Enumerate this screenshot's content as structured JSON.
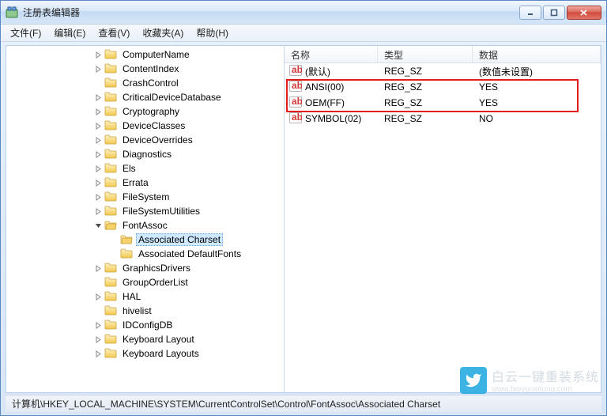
{
  "window": {
    "title": "注册表编辑器"
  },
  "menu": {
    "file": "文件(F)",
    "edit": "编辑(E)",
    "view": "查看(V)",
    "favorites": "收藏夹(A)",
    "help": "帮助(H)"
  },
  "tree": {
    "items": [
      {
        "indent": 110,
        "exp": "collapsed",
        "label": "ComputerName"
      },
      {
        "indent": 110,
        "exp": "collapsed",
        "label": "ContentIndex"
      },
      {
        "indent": 110,
        "exp": "none",
        "label": "CrashControl"
      },
      {
        "indent": 110,
        "exp": "collapsed",
        "label": "CriticalDeviceDatabase"
      },
      {
        "indent": 110,
        "exp": "collapsed",
        "label": "Cryptography"
      },
      {
        "indent": 110,
        "exp": "collapsed",
        "label": "DeviceClasses"
      },
      {
        "indent": 110,
        "exp": "collapsed",
        "label": "DeviceOverrides"
      },
      {
        "indent": 110,
        "exp": "collapsed",
        "label": "Diagnostics"
      },
      {
        "indent": 110,
        "exp": "collapsed",
        "label": "Els"
      },
      {
        "indent": 110,
        "exp": "collapsed",
        "label": "Errata"
      },
      {
        "indent": 110,
        "exp": "collapsed",
        "label": "FileSystem"
      },
      {
        "indent": 110,
        "exp": "collapsed",
        "label": "FileSystemUtilities"
      },
      {
        "indent": 110,
        "exp": "expanded",
        "label": "FontAssoc"
      },
      {
        "indent": 130,
        "exp": "none",
        "label": "Associated Charset",
        "selected": true
      },
      {
        "indent": 130,
        "exp": "none",
        "label": "Associated DefaultFonts"
      },
      {
        "indent": 110,
        "exp": "collapsed",
        "label": "GraphicsDrivers"
      },
      {
        "indent": 110,
        "exp": "none",
        "label": "GroupOrderList"
      },
      {
        "indent": 110,
        "exp": "collapsed",
        "label": "HAL"
      },
      {
        "indent": 110,
        "exp": "none",
        "label": "hivelist"
      },
      {
        "indent": 110,
        "exp": "collapsed",
        "label": "IDConfigDB"
      },
      {
        "indent": 110,
        "exp": "collapsed",
        "label": "Keyboard Layout"
      },
      {
        "indent": 110,
        "exp": "collapsed",
        "label": "Keyboard Layouts"
      }
    ]
  },
  "list": {
    "columns": {
      "name": "名称",
      "type": "类型",
      "data": "数据"
    },
    "rows": [
      {
        "name": "(默认)",
        "type": "REG_SZ",
        "data": "(数值未设置)"
      },
      {
        "name": "ANSI(00)",
        "type": "REG_SZ",
        "data": "YES"
      },
      {
        "name": "OEM(FF)",
        "type": "REG_SZ",
        "data": "YES"
      },
      {
        "name": "SYMBOL(02)",
        "type": "REG_SZ",
        "data": "NO"
      }
    ]
  },
  "status": {
    "path": "计算机\\HKEY_LOCAL_MACHINE\\SYSTEM\\CurrentControlSet\\Control\\FontAssoc\\Associated Charset"
  },
  "watermark": {
    "text": "白云一键重装系统",
    "sub": "www.baiyunxitong.com"
  }
}
